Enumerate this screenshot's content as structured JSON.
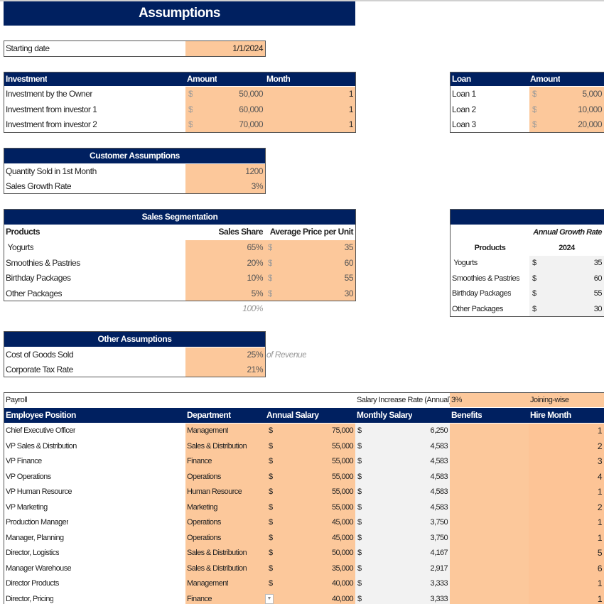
{
  "title": "Assumptions",
  "starting_date": {
    "label": "Starting date",
    "value": "1/1/2024"
  },
  "investment": {
    "headers": {
      "name": "Investment",
      "amount": "Amount",
      "month": "Month"
    },
    "rows": [
      {
        "name": "Investment by the Owner",
        "currency": "$",
        "amount": "50,000",
        "month": "1"
      },
      {
        "name": "Investment from investor 1",
        "currency": "$",
        "amount": "60,000",
        "month": "1"
      },
      {
        "name": "Investment from investor 2",
        "currency": "$",
        "amount": "70,000",
        "month": "1"
      }
    ]
  },
  "loan": {
    "headers": {
      "name": "Loan",
      "amount": "Amount"
    },
    "rows": [
      {
        "name": "Loan 1",
        "currency": "$",
        "amount": "5,000"
      },
      {
        "name": "Loan 2",
        "currency": "$",
        "amount": "10,000"
      },
      {
        "name": "Loan 3",
        "currency": "$",
        "amount": "20,000"
      }
    ]
  },
  "customer": {
    "title": "Customer Assumptions",
    "rows": [
      {
        "label": "Quantity Sold in 1st Month",
        "value": "1200"
      },
      {
        "label": "Sales Growth Rate",
        "value": "3%"
      }
    ]
  },
  "sales_segmentation": {
    "title": "Sales Segmentation",
    "headers": {
      "products": "Products",
      "share": "Sales Share",
      "price": "Average  Price per Unit"
    },
    "rows": [
      {
        "name": " Yogurts",
        "share": "65%",
        "currency": "$",
        "price": "35"
      },
      {
        "name": "Smoothies & Pastries",
        "share": "20%",
        "currency": "$",
        "price": "60"
      },
      {
        "name": "Birthday Packages",
        "share": "10%",
        "currency": "$",
        "price": "55"
      },
      {
        "name": "Other Packages",
        "share": "5%",
        "currency": "$",
        "price": "30"
      }
    ],
    "total_share": "100%"
  },
  "price_growth": {
    "header_note": "Annual Growth Rate",
    "products_label": "Products",
    "year": "2024",
    "rows": [
      {
        "name": " Yogurts",
        "currency": "$",
        "price": "35"
      },
      {
        "name": "Smoothies & Pastries",
        "currency": "$",
        "price": "60"
      },
      {
        "name": "Birthday Packages",
        "currency": "$",
        "price": "55"
      },
      {
        "name": "Other Packages",
        "currency": "$",
        "price": "30"
      }
    ]
  },
  "other": {
    "title": "Other Assumptions",
    "rows": [
      {
        "label": "Cost of Goods Sold",
        "value": "25%",
        "note": "of Revenue"
      },
      {
        "label": "Corporate Tax Rate",
        "value": "21%",
        "note": ""
      }
    ]
  },
  "payroll": {
    "title": "Payroll",
    "increase_label": "Salary Increase Rate (Annual)",
    "increase_value": "3%",
    "increase_mode": "Joining-wise",
    "headers": {
      "position": "Employee Position",
      "department": "Department",
      "annual": "Annual Salary",
      "monthly": "Monthly Salary",
      "benefits": "Benefits",
      "hire": "Hire Month"
    },
    "rows": [
      {
        "position": "Chief Executive Officer",
        "department": "Management",
        "annual": "75,000",
        "monthly": "6,250",
        "hire": "1"
      },
      {
        "position": "VP Sales & Distribution",
        "department": "Sales & Distribution",
        "annual": "55,000",
        "monthly": "4,583",
        "hire": "2"
      },
      {
        "position": "VP Finance",
        "department": "Finance",
        "annual": "55,000",
        "monthly": "4,583",
        "hire": "3"
      },
      {
        "position": "VP Operations",
        "department": "Operations",
        "annual": "55,000",
        "monthly": "4,583",
        "hire": "4"
      },
      {
        "position": "VP Human Resource",
        "department": "Human Resource",
        "annual": "55,000",
        "monthly": "4,583",
        "hire": "1"
      },
      {
        "position": "VP Marketing",
        "department": "Marketing",
        "annual": "55,000",
        "monthly": "4,583",
        "hire": "2"
      },
      {
        "position": "Production Manager",
        "department": "Operations",
        "annual": "45,000",
        "monthly": "3,750",
        "hire": "1"
      },
      {
        "position": "Manager, Planning",
        "department": "Operations",
        "annual": "45,000",
        "monthly": "3,750",
        "hire": "1"
      },
      {
        "position": "Director, Logistics",
        "department": "Sales & Distribution",
        "annual": "50,000",
        "monthly": "4,167",
        "hire": "5"
      },
      {
        "position": "Manager Warehouse",
        "department": "Sales & Distribution",
        "annual": "35,000",
        "monthly": "2,917",
        "hire": "6"
      },
      {
        "position": "Director Products",
        "department": "Management",
        "annual": "40,000",
        "monthly": "3,333",
        "hire": "1"
      },
      {
        "position": "Director, Pricing",
        "department": "Finance",
        "annual": "40,000",
        "monthly": "3,333",
        "hire": "1"
      }
    ],
    "currency": "$"
  }
}
